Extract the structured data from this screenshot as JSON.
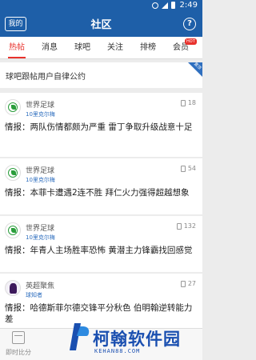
{
  "status_bar": {
    "time": "2:49"
  },
  "header": {
    "mine_label": "我的",
    "title": "社区",
    "help_label": "?"
  },
  "tabs": [
    {
      "label": "热帖",
      "active": true
    },
    {
      "label": "消息"
    },
    {
      "label": "球吧"
    },
    {
      "label": "关注"
    },
    {
      "label": "排榜"
    },
    {
      "label": "会员",
      "badge": "HOT"
    }
  ],
  "notice": {
    "text": "球吧跟帖用户自律公约",
    "corner": "置顶"
  },
  "posts": [
    {
      "author": "世界足球",
      "sub": "10里克尔梅",
      "comments": "18",
      "title": "情报：两队伤情都颇为严重 雷丁争取升级战意十足",
      "avatar": "soccer-logo"
    },
    {
      "author": "世界足球",
      "sub": "10里克尔梅",
      "comments": "54",
      "title": "情报：本菲卡遭遇2连不胜 拜仁火力强得超越想象",
      "avatar": "soccer-logo"
    },
    {
      "author": "世界足球",
      "sub": "10里克尔梅",
      "comments": "132",
      "title": "情报：年青人主场胜率恐怖 黄潜主力锋霸找回感觉",
      "avatar": "soccer-logo"
    },
    {
      "author": "英超聚焦",
      "sub": "球知者",
      "comments": "27",
      "title": "情报：哈德斯菲尔德交锋平分秋色 伯明翰逆转能力差",
      "avatar": "premier-league-logo"
    }
  ],
  "bottom_nav": {
    "label": "即时比分"
  },
  "watermark": {
    "brand": "柯翰软件园",
    "domain": "KEHAN88.COM"
  },
  "colors": {
    "primary": "#1e5fa8",
    "accent": "#e8322d",
    "link": "#2f6fbf"
  }
}
